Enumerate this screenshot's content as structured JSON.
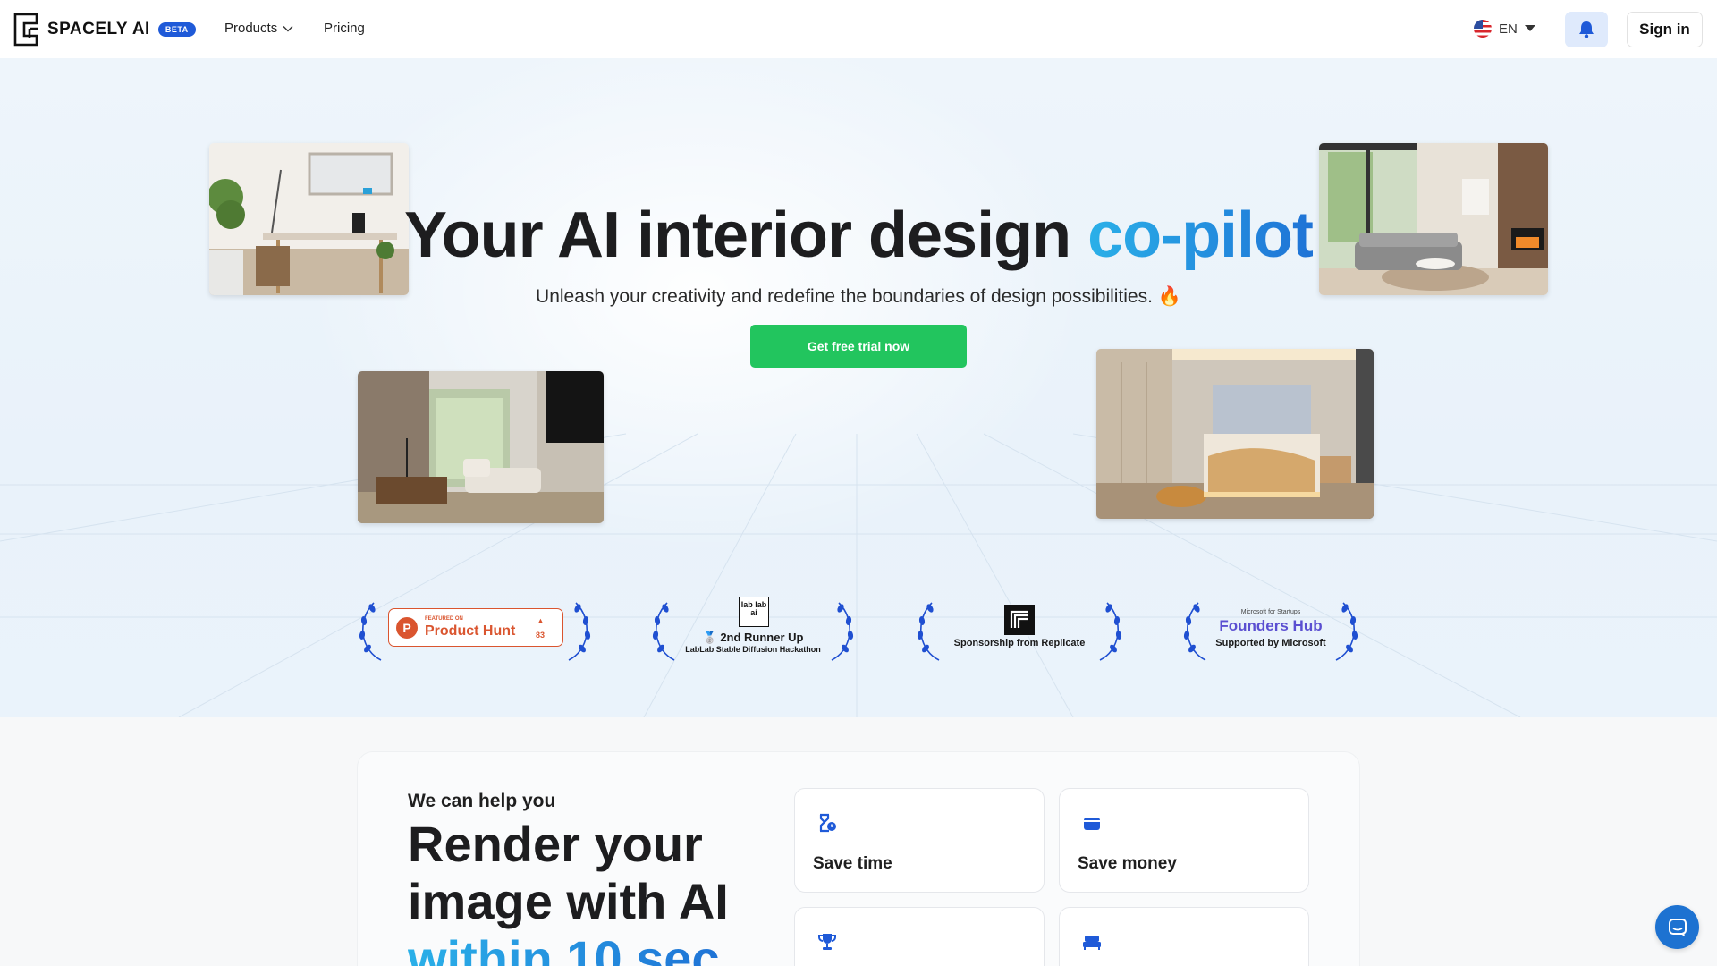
{
  "header": {
    "logo_text": "SPACELY AI",
    "beta_badge": "BETA",
    "nav": {
      "products": "Products",
      "pricing": "Pricing"
    },
    "language": "EN",
    "sign_in": "Sign in"
  },
  "hero": {
    "title_main": "Your AI interior design",
    "title_accent": "co-pilot",
    "subtitle": "Unleash your creativity and redefine the boundaries of design possibilities. 🔥",
    "cta": "Get free trial now"
  },
  "awards": [
    {
      "small": "FEATURED ON",
      "name": "Product Hunt",
      "count": "83"
    },
    {
      "logo": "lab lab ai",
      "title": "🥈 2nd Runner Up",
      "subtitle": "LabLab Stable Diffusion Hackathon"
    },
    {
      "title": "Sponsorship from Replicate"
    },
    {
      "small": "Microsoft for Startups",
      "name": "Founders Hub",
      "subtitle": "Supported by Microsoft"
    }
  ],
  "features": {
    "label": "We can help you",
    "title": "Render your image with AI",
    "title_accent": "within 10 sec",
    "items": [
      {
        "label": "Save time",
        "icon": "hourglass-clock-icon"
      },
      {
        "label": "Save money",
        "icon": "wallet-icon"
      },
      {
        "label": "",
        "icon": "trophy-icon"
      },
      {
        "label": "",
        "icon": "bed-icon"
      }
    ]
  },
  "colors": {
    "accent_blue": "#1f73d6",
    "accent_cyan": "#2ab0e8",
    "cta_green": "#22c55e",
    "product_hunt": "#da552f",
    "beta_badge": "#1f5ad8",
    "icon_blue": "#1f5ad8"
  }
}
